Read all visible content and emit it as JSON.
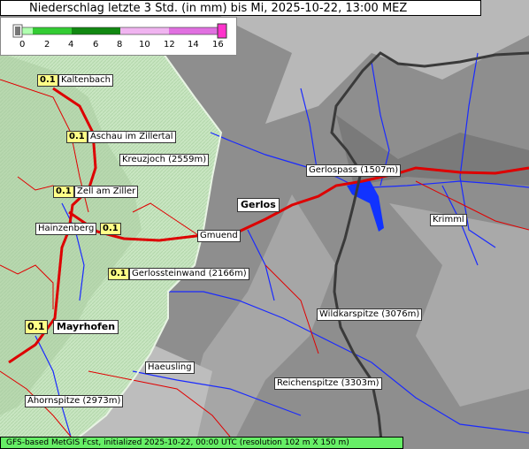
{
  "title": "Niederschlag letzte 3 Std. (in mm) bis Mi, 2025-10-22, 13:00 MEZ",
  "legend": {
    "ticks": [
      "0",
      "2",
      "4",
      "6",
      "8",
      "10",
      "12",
      "14",
      "16"
    ],
    "colors": {
      "zero": "#b0ffb0",
      "low": "#33cc33",
      "mid": "#118811",
      "high1": "#f0b4f0",
      "high2": "#e070e0",
      "max": "#ff33cc"
    }
  },
  "places": {
    "kaltenbach": "Kaltenbach",
    "aschau": "Aschau im Zillertal",
    "kreuzjoch": "Kreuzjoch (2559m)",
    "zell": "Zell am Ziller",
    "hainzenberg": "Hainzenberg",
    "gmuend": "Gmuend",
    "gerlos": "Gerlos",
    "gerlospass": "Gerlospass (1507m)",
    "krimml": "Krimml",
    "gerlossteinwand": "Gerlossteinwand (2166m)",
    "wildkarspitze": "Wildkarspitze (3076m)",
    "mayrhofen": "Mayrhofen",
    "haeusling": "Haeusling",
    "reichenspitze": "Reichenspitze (3303m)",
    "ahornspitze": "Ahornspitze (2973m)"
  },
  "values": {
    "kaltenbach": "0.1",
    "aschau": "0.1",
    "zell": "0.1",
    "hainzenberg": "0.1",
    "gerlossteinwand": "0.1",
    "mayrhofen": "0.1"
  },
  "footer": "GFS-based MetGIS Fcst, initialized 2025-10-22, 00:00 UTC  (resolution 102 m X 150 m)"
}
